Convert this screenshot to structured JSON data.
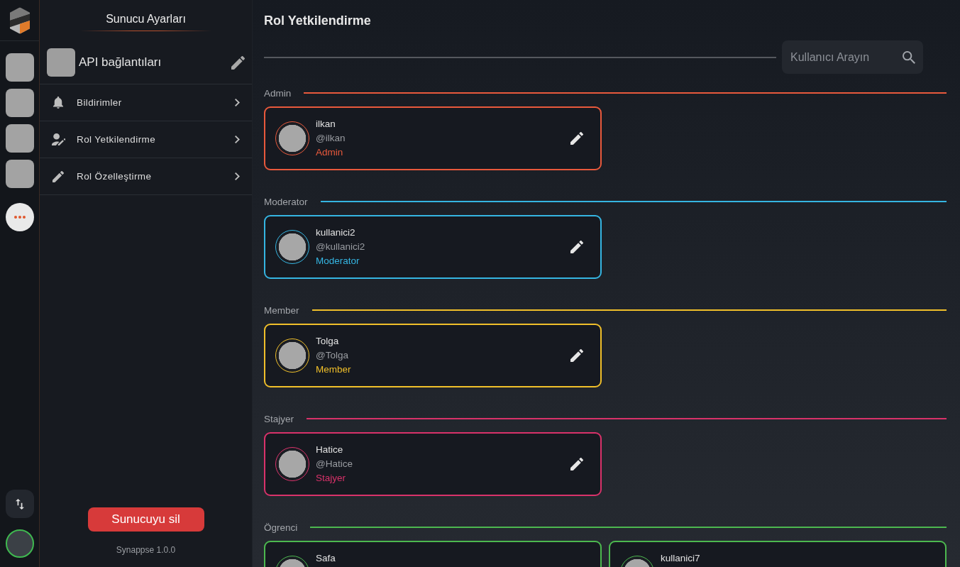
{
  "sidebar": {
    "title": "Sunucu Ayarları",
    "server_name": "API bağlantıları",
    "items": [
      {
        "label": "Bildirimler",
        "kind": "bell"
      },
      {
        "label": "Rol Yetkilendirme",
        "kind": "person"
      },
      {
        "label": "Rol Özelleştirme",
        "kind": "pencil"
      }
    ],
    "delete_button": "Sunucuyu sil",
    "version": "Synappse 1.0.0"
  },
  "main": {
    "title": "Rol Yetkilendirme",
    "search": {
      "placeholder": "Kullanıcı Arayın"
    },
    "roles": [
      {
        "name": "Admin",
        "color": "#e8593c",
        "members": [
          {
            "name": "ilkan",
            "handle": "@ilkan",
            "role": "Admin"
          }
        ]
      },
      {
        "name": "Moderator",
        "color": "#35b5e2",
        "members": [
          {
            "name": "kullanici2",
            "handle": "@kullanici2",
            "role": "Moderator"
          }
        ]
      },
      {
        "name": "Member",
        "color": "#f0bf2a",
        "members": [
          {
            "name": "Tolga",
            "handle": "@Tolga",
            "role": "Member"
          }
        ]
      },
      {
        "name": "Stajyer",
        "color": "#d9326a",
        "members": [
          {
            "name": "Hatice",
            "handle": "@Hatice",
            "role": "Stajyer"
          }
        ]
      },
      {
        "name": "Ögrenci",
        "color": "#4cb84f",
        "members": [
          {
            "name": "Safa"
          },
          {
            "name": "kullanici7"
          }
        ]
      }
    ]
  }
}
